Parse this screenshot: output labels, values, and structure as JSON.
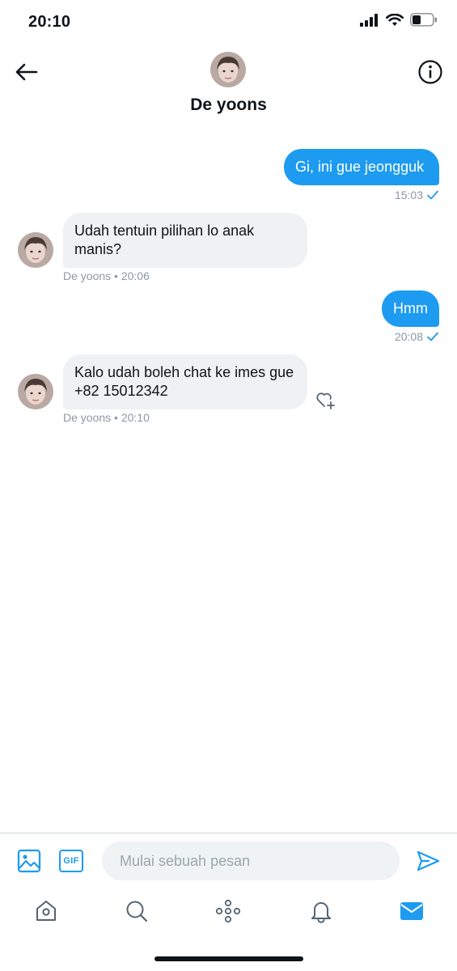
{
  "status_bar": {
    "time": "20:10"
  },
  "header": {
    "contact_name": "De yoons"
  },
  "messages": [
    {
      "direction": "outgoing",
      "text": "Gi, ini gue jeongguk",
      "time": "15:03"
    },
    {
      "direction": "incoming",
      "text": "Udah tentuin pilihan lo anak manis?",
      "meta": "De yoons • 20:06"
    },
    {
      "direction": "outgoing",
      "text": "Hmm",
      "time": "20:08"
    },
    {
      "direction": "incoming",
      "text": "Kalo udah boleh chat ke imes gue +82 15012342",
      "meta": "De yoons • 20:10"
    }
  ],
  "composer": {
    "placeholder": "Mulai sebuah pesan",
    "gif_label": "GIF"
  },
  "tabs": [
    {
      "name": "home",
      "icon": "home-icon"
    },
    {
      "name": "search",
      "icon": "search-icon"
    },
    {
      "name": "spaces",
      "icon": "spaces-icon"
    },
    {
      "name": "notifications",
      "icon": "bell-icon"
    },
    {
      "name": "messages",
      "icon": "mail-icon",
      "active": true
    }
  ],
  "colors": {
    "accent": "#1d9bf0",
    "incoming_bubble": "#eff1f3",
    "text": "#0f1419",
    "muted": "#8b98a5",
    "tab_icon": "#536471"
  }
}
